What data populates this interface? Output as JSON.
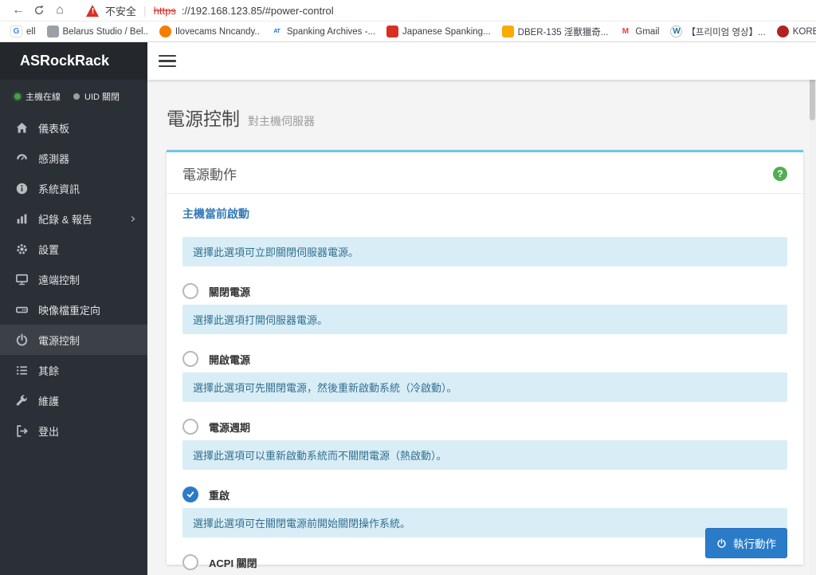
{
  "browser": {
    "security_label": "不安全",
    "url_scheme": "https",
    "url_rest": "://192.168.123.85/#power-control",
    "bookmarks": [
      {
        "label": "ell",
        "icon": "google"
      },
      {
        "label": "Belarus Studio / Bel..",
        "icon": "site-gray"
      },
      {
        "label": "Ilovecams Nncandy..",
        "icon": "site-orange"
      },
      {
        "label": "Spanking Archives -...",
        "icon": "at-blue"
      },
      {
        "label": "Japanese Spanking...",
        "icon": "site-red"
      },
      {
        "label": "DBER-135 淫獸獵奇...",
        "icon": "site-yellow"
      },
      {
        "label": "Gmail",
        "icon": "gmail"
      },
      {
        "label": "【프리미엄 영상】...",
        "icon": "wordpress"
      },
      {
        "label": "KOREAN HOT – Kor...",
        "icon": "site-darkred"
      }
    ]
  },
  "sidebar": {
    "brand": "ASRockRack",
    "status": [
      {
        "label": "主機在線",
        "state": "online"
      },
      {
        "label": "UID 關閉",
        "state": "off"
      }
    ],
    "items": [
      {
        "key": "dashboard",
        "label": "儀表板",
        "icon": "home"
      },
      {
        "key": "sensors",
        "label": "感測器",
        "icon": "gauge"
      },
      {
        "key": "system-info",
        "label": "系統資訊",
        "icon": "info"
      },
      {
        "key": "logs-reports",
        "label": "紀錄 & 報告",
        "icon": "chart",
        "chevron": true
      },
      {
        "key": "settings",
        "label": "設置",
        "icon": "gear"
      },
      {
        "key": "remote-control",
        "label": "遠端控制",
        "icon": "monitor"
      },
      {
        "key": "image-redirection",
        "label": "映像檔重定向",
        "icon": "disk"
      },
      {
        "key": "power-control",
        "label": "電源控制",
        "icon": "power",
        "active": true
      },
      {
        "key": "misc",
        "label": "其餘",
        "icon": "list"
      },
      {
        "key": "maintenance",
        "label": "維護",
        "icon": "wrench"
      },
      {
        "key": "logout",
        "label": "登出",
        "icon": "logout"
      }
    ]
  },
  "page": {
    "title": "電源控制",
    "subtitle": "對主機伺服器",
    "card_title": "電源動作",
    "help_glyph": "?",
    "current_state": "主機當前啟動",
    "options": [
      {
        "key": "power-off",
        "label": "關閉電源",
        "checked": false,
        "description": "選擇此選項可立即關閉伺服器電源。"
      },
      {
        "key": "power-on",
        "label": "開啟電源",
        "checked": false,
        "description": "選擇此選項打開伺服器電源。"
      },
      {
        "key": "power-cycle",
        "label": "電源週期",
        "checked": false,
        "description": "選擇此選項可先關閉電源，然後重新啟動系統（冷啟動）。"
      },
      {
        "key": "restart",
        "label": "重啟",
        "checked": true,
        "description": "選擇此選項可以重新啟動系統而不關閉電源（熱啟動）。"
      },
      {
        "key": "acpi-shutdown",
        "label": "ACPI 關閉",
        "checked": false,
        "description": "選擇此選項可在關閉電源前開始關閉操作系統。"
      }
    ],
    "execute_label": "執行動作"
  },
  "colors": {
    "accent": "#2a7cc9",
    "info_bg": "#d9edf7",
    "info_text": "#31708f",
    "help_green": "#53ae53",
    "online_green": "#43a047",
    "card_top_border": "#6ec6e5",
    "warning_red": "#d93025"
  }
}
